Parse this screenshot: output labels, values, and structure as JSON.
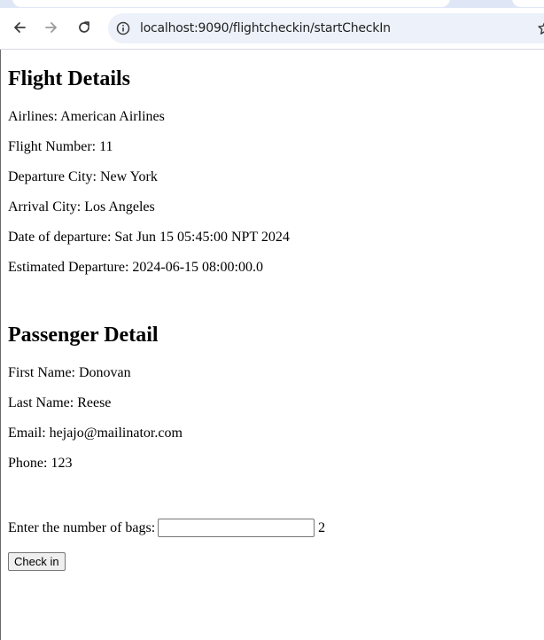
{
  "browser": {
    "url": "localhost:9090/flightcheckin/startCheckIn",
    "icons": {
      "back": "arrow-left",
      "forward": "arrow-right",
      "reload": "reload",
      "site_info": "info-circle",
      "bookmark": "star"
    }
  },
  "flight": {
    "heading": "Flight Details",
    "airlines": "Airlines: American Airlines",
    "flight_number": "Flight Number: 11",
    "departure_city": "Departure City: New York",
    "arrival_city": "Arrival City: Los Angeles",
    "date_of_departure": "Date of departure: Sat Jun 15 05:45:00 NPT 2024",
    "estimated_departure": "Estimated Departure: 2024-06-15 08:00:00.0"
  },
  "passenger": {
    "heading": "Passenger Detail",
    "first_name": "First Name: Donovan",
    "last_name": "Last Name: Reese",
    "email": "Email: hejajo@mailinator.com",
    "phone": "Phone: 123"
  },
  "form": {
    "bags_label": "Enter the number of bags:",
    "bags_value": "",
    "bags_suffix": "2",
    "submit_label": "Check in"
  },
  "colors": {
    "tab_strip": "#dfe7f6",
    "omnibox": "#edf1f9",
    "button_bg": "#efefef"
  }
}
